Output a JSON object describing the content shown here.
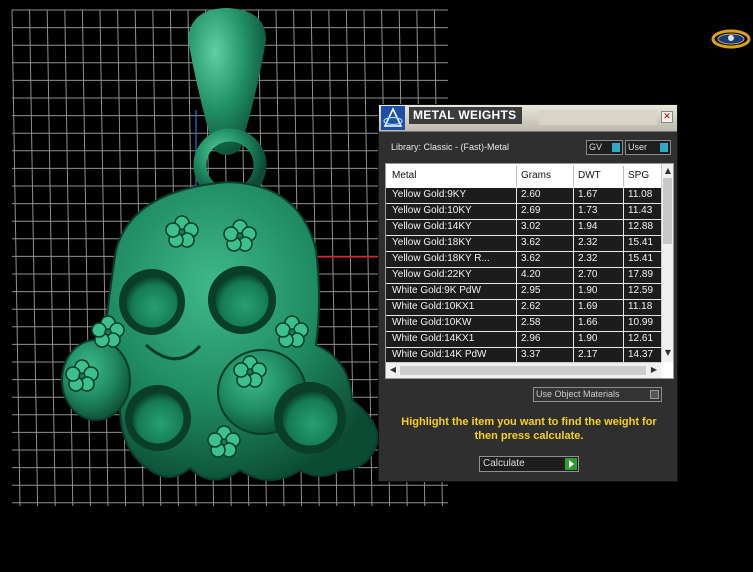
{
  "panel": {
    "title": "METAL WEIGHTS",
    "close_glyph": "✕",
    "library_label": "Library: Classic - (Fast)-Metal",
    "gv_label": "GV",
    "user_label": "User",
    "columns": [
      "Metal",
      "Grams",
      "DWT",
      "SPG"
    ],
    "rows": [
      {
        "metal": "Yellow Gold:9KY",
        "grams": "2.60",
        "dwt": "1.67",
        "spg": "11.08"
      },
      {
        "metal": "Yellow Gold:10KY",
        "grams": "2.69",
        "dwt": "1.73",
        "spg": "11.43"
      },
      {
        "metal": "Yellow Gold:14KY",
        "grams": "3.02",
        "dwt": "1.94",
        "spg": "12.88"
      },
      {
        "metal": "Yellow Gold:18KY",
        "grams": "3.62",
        "dwt": "2.32",
        "spg": "15.41"
      },
      {
        "metal": "Yellow Gold:18KY R...",
        "grams": "3.62",
        "dwt": "2.32",
        "spg": "15.41"
      },
      {
        "metal": "Yellow Gold:22KY",
        "grams": "4.20",
        "dwt": "2.70",
        "spg": "17.89"
      },
      {
        "metal": "White Gold:9K PdW",
        "grams": "2.95",
        "dwt": "1.90",
        "spg": "12.59"
      },
      {
        "metal": "White Gold:10KX1",
        "grams": "2.62",
        "dwt": "1.69",
        "spg": "11.18"
      },
      {
        "metal": "White Gold:10KW",
        "grams": "2.58",
        "dwt": "1.66",
        "spg": "10.99"
      },
      {
        "metal": "White Gold:14KX1",
        "grams": "2.96",
        "dwt": "1.90",
        "spg": "12.61"
      },
      {
        "metal": "White Gold:14K PdW",
        "grams": "3.37",
        "dwt": "2.17",
        "spg": "14.37"
      }
    ],
    "use_object_materials_label": "Use Object Materials",
    "instruction_text": "Highlight the item you want to find the weight for then press calculate.",
    "calculate_label": "Calculate"
  },
  "viewport": {
    "model_color": "#1f8a62",
    "grid_color": "#9a9a9a",
    "axis_color": "#cc1111"
  }
}
